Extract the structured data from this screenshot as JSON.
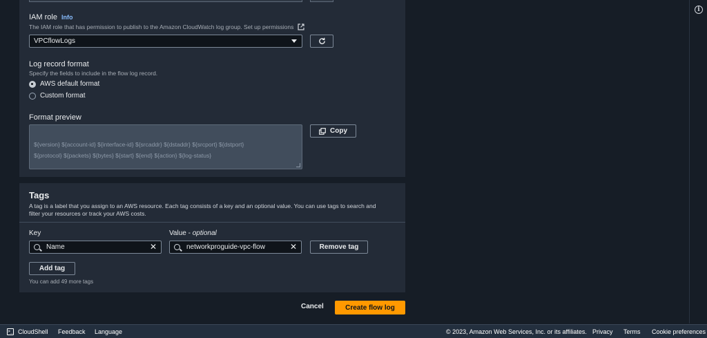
{
  "iam": {
    "label": "IAM role",
    "info": "Info",
    "description": "The IAM role that has permission to publish to the Amazon CloudWatch log group. Set up permissions",
    "selected": "VPCflowLogs"
  },
  "log_format": {
    "label": "Log record format",
    "description": "Specify the fields to include in the flow log record.",
    "options": [
      "AWS default format",
      "Custom format"
    ],
    "selected_index": 0
  },
  "preview": {
    "label": "Format preview",
    "text": "${version} ${account-id} ${interface-id} ${srcaddr} ${dstaddr} ${srcport} ${dstport}\n${protocol} ${packets} ${bytes} ${start} ${end} ${action} ${log-status}",
    "copy_label": "Copy"
  },
  "tags": {
    "title": "Tags",
    "description": "A tag is a label that you assign to an AWS resource. Each tag consists of a key and an optional value. You can use tags to search and filter your resources or track your AWS costs.",
    "key_label": "Key",
    "value_label": "Value",
    "value_optional": "optional",
    "key_value": "Name",
    "value_value": "networkproguide-vpc-flow",
    "remove_label": "Remove tag",
    "add_label": "Add tag",
    "remaining": "You can add 49 more tags"
  },
  "actions": {
    "cancel": "Cancel",
    "create": "Create flow log"
  },
  "footer": {
    "cloudshell": "CloudShell",
    "feedback": "Feedback",
    "language": "Language",
    "copyright": "© 2023, Amazon Web Services, Inc. or its affiliates.",
    "privacy": "Privacy",
    "terms": "Terms",
    "cookies": "Cookie preferences"
  },
  "colors": {
    "primary_button": "#ff9900",
    "panel": "#232b37",
    "background": "#161d26"
  }
}
